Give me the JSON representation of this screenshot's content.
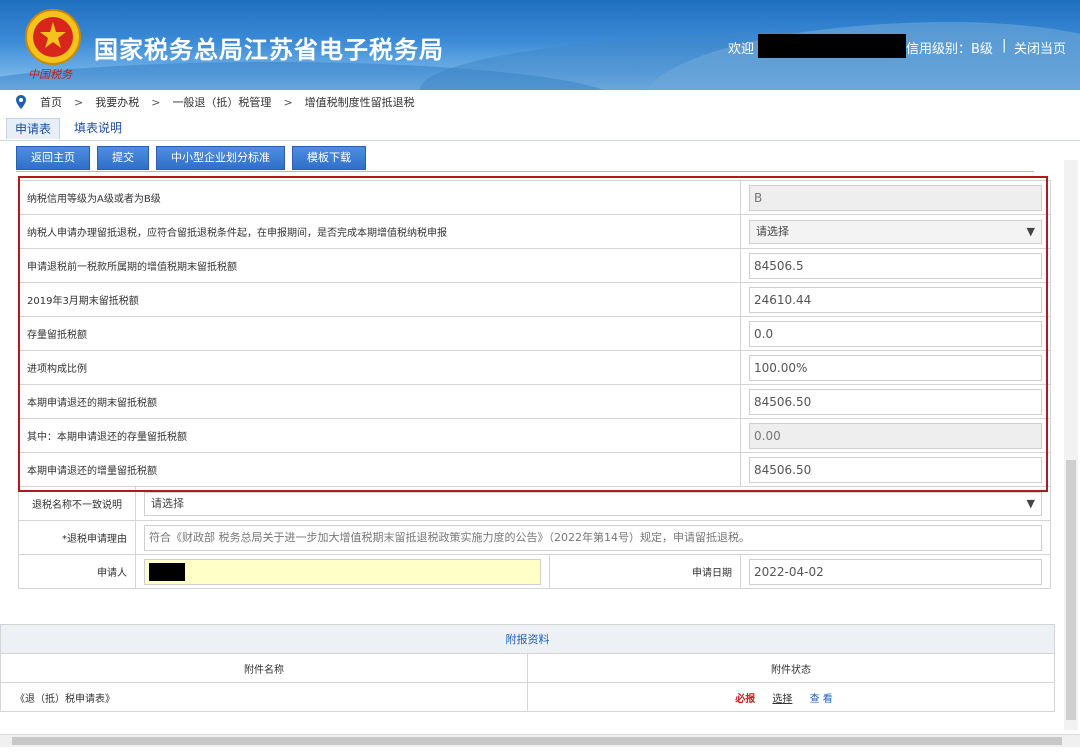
{
  "header": {
    "site_title": "国家税务总局江苏省电子税务局",
    "emblem_signature": "中国税务",
    "welcome": "欢迎",
    "credit_level": "信用级别：B级",
    "separator": "|",
    "close_page": "关闭当页"
  },
  "breadcrumb": {
    "items": [
      "首页",
      "我要办税",
      "一般退（抵）税管理",
      "增值税制度性留抵退税"
    ],
    "separator": ">"
  },
  "tabs": [
    {
      "label": "申请表",
      "active": true
    },
    {
      "label": "填表说明",
      "active": false
    }
  ],
  "toolbar": {
    "buttons": [
      "返回主页",
      "提交",
      "中小型企业划分标准",
      "模板下载"
    ]
  },
  "form": {
    "rows": [
      {
        "label": "纳税信用等级为A级或者为B级",
        "value": "B",
        "kind": "disabled"
      },
      {
        "label": "纳税人申请办理留抵退税，应符合留抵退税条件起，在申报期间，是否完成本期增值税纳税申报",
        "value": "请选择",
        "kind": "select"
      },
      {
        "label": "申请退税前一税款所属期的增值税期末留抵税额",
        "value": "84506.5",
        "kind": "input"
      },
      {
        "label": "2019年3月期末留抵税额",
        "value": "24610.44",
        "kind": "input"
      },
      {
        "label": "存量留抵税额",
        "value": "0.0",
        "kind": "input"
      },
      {
        "label": "进项构成比例",
        "value": "100.00%",
        "kind": "input"
      },
      {
        "label": "本期申请退还的期末留抵税额",
        "value": "84506.50",
        "kind": "input"
      },
      {
        "label": "其中：本期申请退还的存量留抵税额",
        "value": "0.00",
        "kind": "disabled"
      },
      {
        "label": "本期申请退还的增量留抵税额",
        "value": "84506.50",
        "kind": "input"
      }
    ],
    "name_mismatch_label": "退税名称不一致说明",
    "name_mismatch_value": "请选择",
    "reason_label": "*退税申请理由",
    "reason_value": "符合《财政部 税务总局关于进一步加大增值税期末留抵退税政策实施力度的公告》（2022年第14号）规定，申请留抵退税。",
    "applicant_label": "申请人",
    "date_label": "申请日期",
    "date_value": "2022-04-02"
  },
  "attachments": {
    "title": "附报资料",
    "col_name": "附件名称",
    "col_status": "附件状态",
    "rows": [
      {
        "name": "《退（抵）税申请表》",
        "required": "必报",
        "select": "选择",
        "view": "查 看"
      }
    ]
  },
  "colors": {
    "header_blue": "#2a77c8",
    "highlight_red": "#b11a1a",
    "required_red": "#d11a1a",
    "link_blue": "#1a63b8",
    "button_blue": "#3a7bd5"
  }
}
